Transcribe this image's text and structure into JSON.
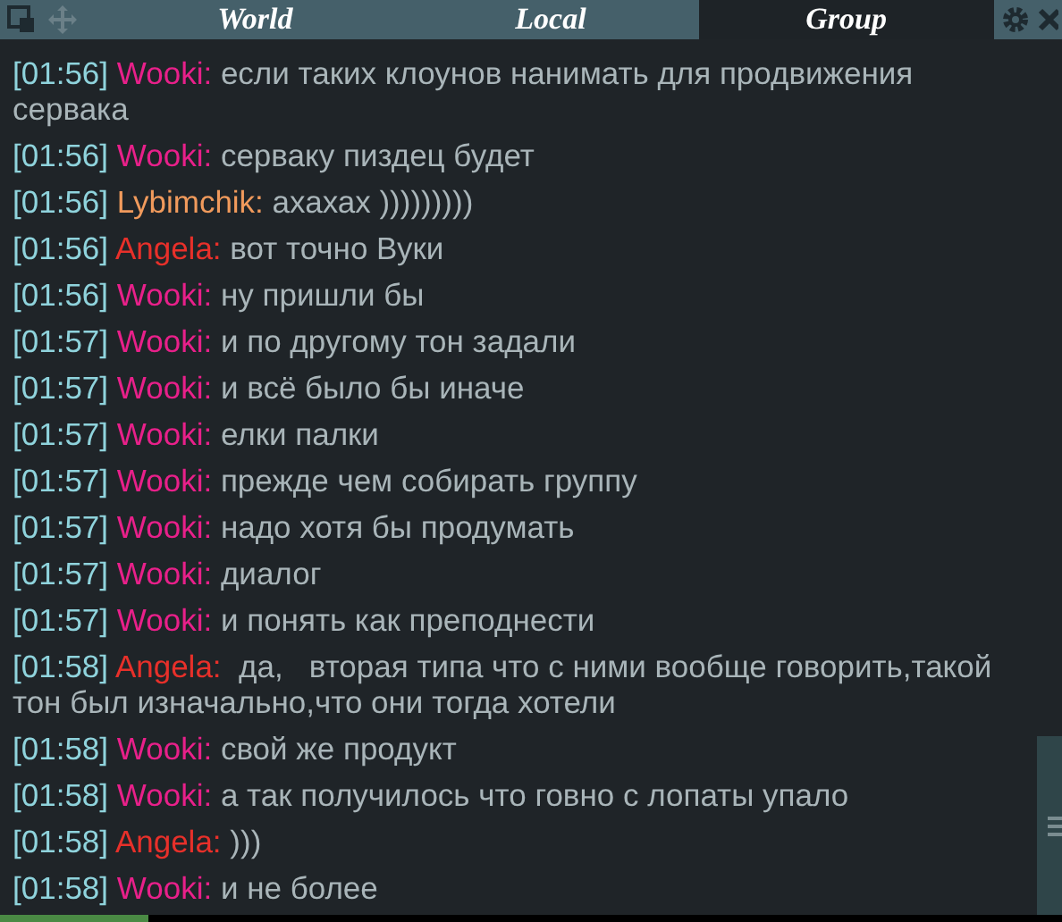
{
  "tabs": [
    {
      "label": "World",
      "selected": false
    },
    {
      "label": "Local",
      "selected": false
    },
    {
      "label": "Group",
      "selected": true
    }
  ],
  "messages": [
    {
      "time": "[01:56]",
      "author": "Wooki:",
      "color": "#e8208a",
      "text": "если таких клоунов нанимать для продвижения",
      "more": "сервака"
    },
    {
      "time": "[01:56]",
      "author": "Wooki:",
      "color": "#e8208a",
      "text": "серваку пиздец будет"
    },
    {
      "time": "[01:56]",
      "author": "Lybimchik:",
      "color": "#f09a5c",
      "text": "ахахах )))))))))"
    },
    {
      "time": "[01:56]",
      "author": "Angela:",
      "color": "#e8302a",
      "text": "вот точно Вуки"
    },
    {
      "time": "[01:56]",
      "author": "Wooki:",
      "color": "#e8208a",
      "text": "ну пришли бы"
    },
    {
      "time": "[01:57]",
      "author": "Wooki:",
      "color": "#e8208a",
      "text": "и по другому тон задали"
    },
    {
      "time": "[01:57]",
      "author": "Wooki:",
      "color": "#e8208a",
      "text": "и всё было бы иначе"
    },
    {
      "time": "[01:57]",
      "author": "Wooki:",
      "color": "#e8208a",
      "text": "елки палки"
    },
    {
      "time": "[01:57]",
      "author": "Wooki:",
      "color": "#e8208a",
      "text": "прежде чем собирать группу"
    },
    {
      "time": "[01:57]",
      "author": "Wooki:",
      "color": "#e8208a",
      "text": "надо хотя бы продумать"
    },
    {
      "time": "[01:57]",
      "author": "Wooki:",
      "color": "#e8208a",
      "text": "диалог"
    },
    {
      "time": "[01:57]",
      "author": "Wooki:",
      "color": "#e8208a",
      "text": "и понять как преподнести"
    },
    {
      "time": "[01:58]",
      "author": "Angela:",
      "color": "#e8302a",
      "text": " да,   вторая типа что с ними вообще говорить,такой",
      "more": "тон был изначально,что они тогда хотели"
    },
    {
      "time": "[01:58]",
      "author": "Wooki:",
      "color": "#e8208a",
      "text": "свой же продукт"
    },
    {
      "time": "[01:58]",
      "author": "Wooki:",
      "color": "#e8208a",
      "text": "а так получилось что говно с лопаты упало"
    },
    {
      "time": "[01:58]",
      "author": "Angela:",
      "color": "#e8302a",
      "text": ")))"
    },
    {
      "time": "[01:58]",
      "author": "Wooki:",
      "color": "#e8208a",
      "text": "и не более"
    }
  ]
}
